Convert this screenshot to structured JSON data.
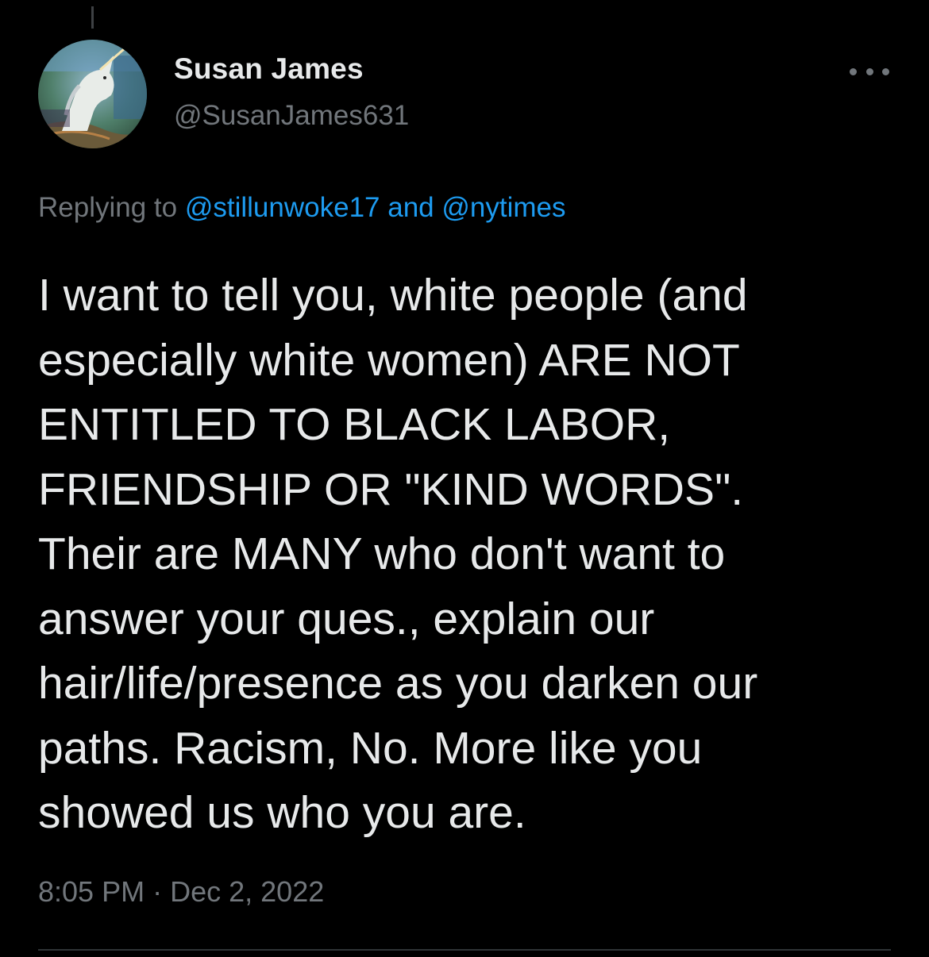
{
  "author": {
    "name": "Susan James",
    "handle": "@SusanJames631",
    "avatar_icon": "unicorn-avatar"
  },
  "reply": {
    "prefix": "Replying to",
    "mention_1": "@stillunwoke17",
    "conjunction": "and",
    "mention_2": "@nytimes"
  },
  "tweet": {
    "lines": [
      "I want to tell you, white people (and",
      "especially white women) ARE NOT",
      "ENTITLED TO BLACK LABOR,",
      "FRIENDSHIP OR \"KIND WORDS\".",
      "Their are MANY who don't want to",
      "answer your ques., explain our",
      "hair/life/presence as you darken our",
      "paths. Racism, No. More like you",
      "showed us who you are."
    ]
  },
  "meta": {
    "time": "8:05 PM",
    "separator": "·",
    "date": "Dec 2, 2022"
  },
  "colors": {
    "background": "#000000",
    "text_primary": "#e7e9ea",
    "text_secondary": "#71767b",
    "link": "#1d9bf0",
    "divider": "#2f3336"
  }
}
